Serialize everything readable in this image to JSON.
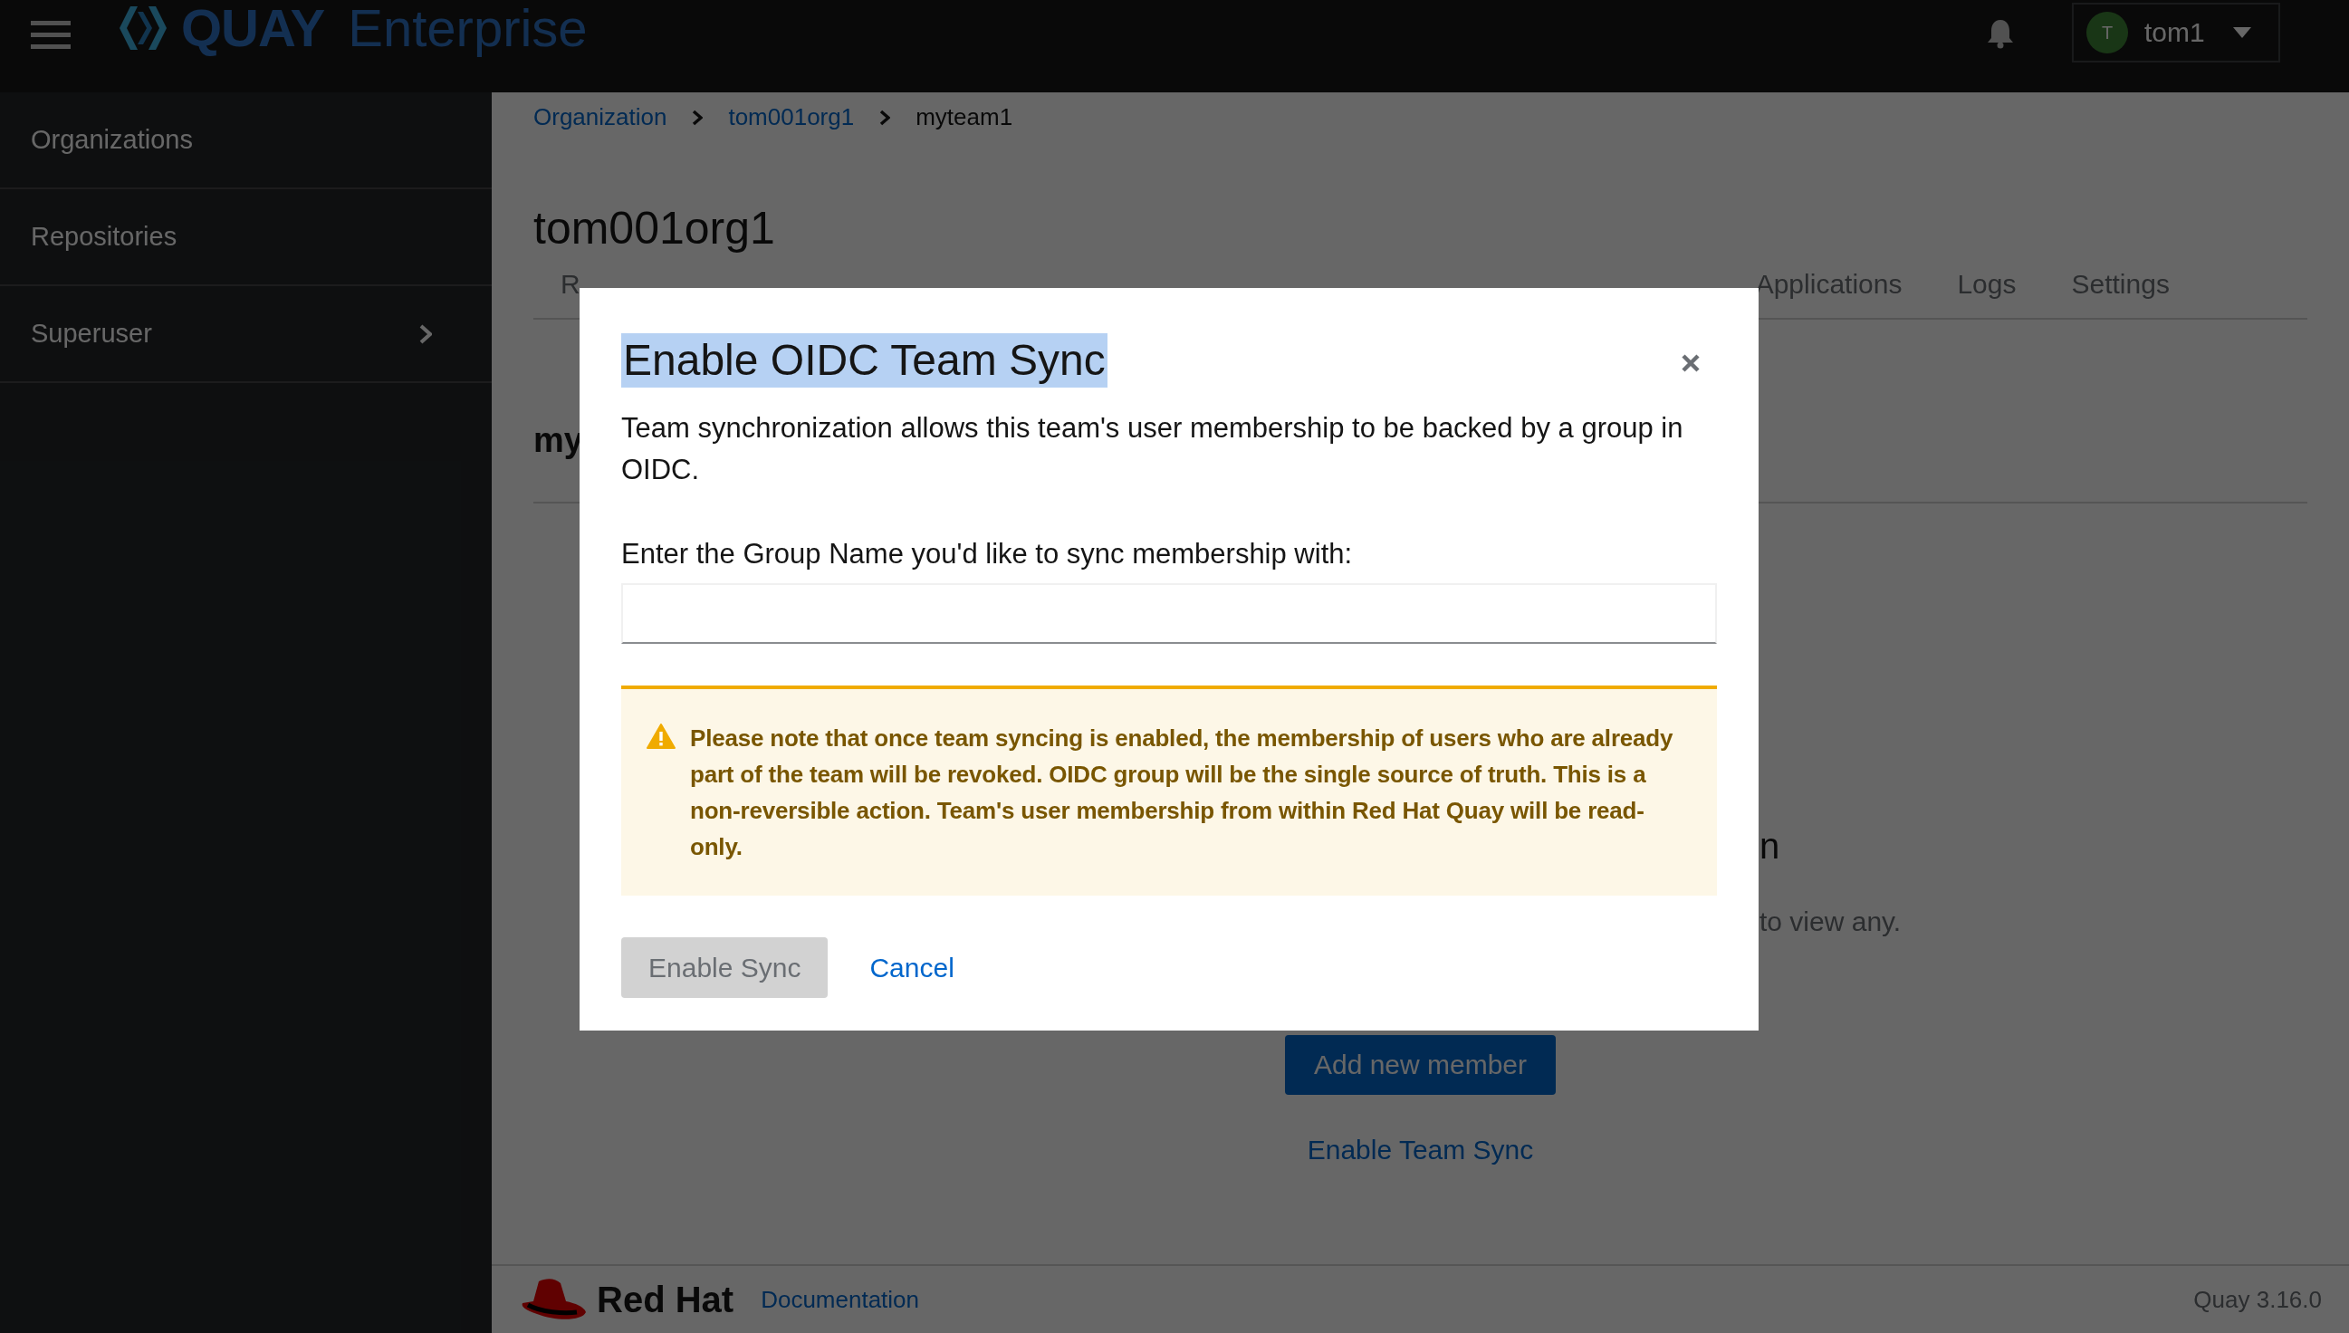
{
  "header": {
    "logo": {
      "brand": "QUAY",
      "product": "Enterprise"
    },
    "user": {
      "initial": "T",
      "name": "tom1"
    }
  },
  "sidebar": {
    "items": [
      {
        "label": "Organizations",
        "expandable": false
      },
      {
        "label": "Repositories",
        "expandable": false
      },
      {
        "label": "Superuser",
        "expandable": true
      }
    ]
  },
  "breadcrumb": [
    {
      "label": "Organization",
      "link": true
    },
    {
      "label": "tom001org1",
      "link": true
    },
    {
      "label": "myteam1",
      "link": false
    }
  ],
  "org_title": "tom001org1",
  "tabs": [
    {
      "label": "R",
      "selected": false
    },
    {
      "label": "Applications",
      "selected": false
    },
    {
      "label": "Logs",
      "selected": false
    },
    {
      "label": "Settings",
      "selected": false
    }
  ],
  "team_heading": "my",
  "members_heading": "n",
  "empty_text": "to view any.",
  "add_member_button": "Add new member",
  "team_sync_link": "Enable Team Sync",
  "footer": {
    "brand": "Red Hat",
    "link": "Documentation",
    "version": "Quay 3.16.0"
  },
  "modal": {
    "title": "Enable OIDC Team Sync",
    "title_highlighted": true,
    "description": "Team synchronization allows this team's user membership to be backed by a group in OIDC.",
    "field_label": "Enter the Group Name you'd like to sync membership with:",
    "warning": "Please note that once team syncing is enabled, the membership of users who are already part of the team will be revoked. OIDC group will be the single source of truth. This is a non-reversible action. Team's user membership from within Red Hat Quay will be read-only.",
    "primary_button": {
      "label": "Enable Sync",
      "disabled": true
    },
    "cancel": "Cancel"
  }
}
